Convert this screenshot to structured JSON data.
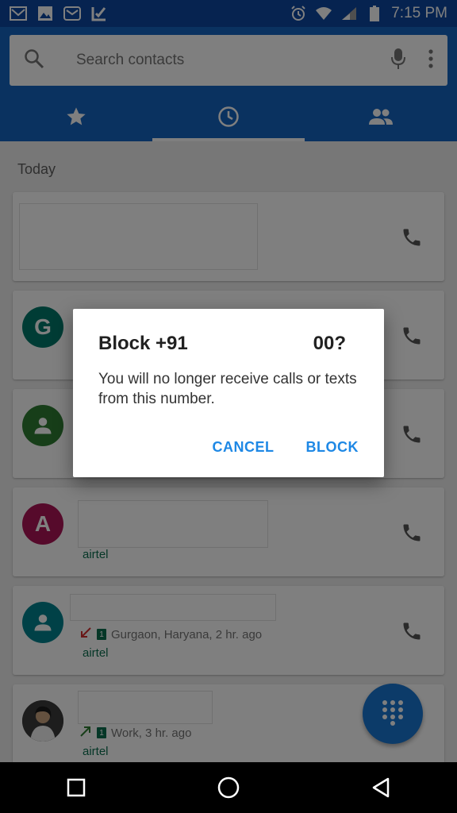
{
  "status_bar": {
    "time": "7:15 PM",
    "left_icons": [
      "gmail-icon",
      "gallery-icon",
      "email-icon",
      "tasks-icon"
    ],
    "right_icons": [
      "alarm-icon",
      "wifi-icon",
      "signal-icon",
      "battery-icon"
    ]
  },
  "search": {
    "placeholder": "Search contacts"
  },
  "tabs": [
    {
      "icon": "star-icon",
      "name": "favorites"
    },
    {
      "icon": "clock-icon",
      "name": "recents",
      "active": true
    },
    {
      "icon": "people-icon",
      "name": "contacts"
    }
  ],
  "section": {
    "label": "Today"
  },
  "calls": [
    {
      "avatar_letter": "",
      "avatar_color": "#00796b",
      "meta": "",
      "carrier": ""
    },
    {
      "avatar_letter": "G",
      "avatar_color": "#00796b",
      "meta": "",
      "carrier": ""
    },
    {
      "avatar_letter": "",
      "avatar_color": "#2e7d32",
      "meta": "",
      "carrier": ""
    },
    {
      "avatar_letter": "A",
      "avatar_color": "#ad1457",
      "meta": "",
      "carrier": "airtel"
    },
    {
      "avatar_letter": "",
      "avatar_color": "#00838f",
      "meta": "Gurgaon, Haryana, 2 hr. ago",
      "carrier": "airtel",
      "sim": "1"
    },
    {
      "avatar_letter": "",
      "avatar_color": "#555555",
      "meta": "Work, 3 hr. ago",
      "carrier": "airtel",
      "sim": "1"
    }
  ],
  "dialog": {
    "title_start": "Block +91",
    "title_end": "00?",
    "message": "You will no longer receive calls or texts from this number.",
    "cancel_label": "CANCEL",
    "block_label": "BLOCK"
  },
  "colors": {
    "status_bar": "#0d47a1",
    "app_bar": "#1565c0",
    "accent": "#1e88e5",
    "carrier_text": "#0b6e4f"
  }
}
